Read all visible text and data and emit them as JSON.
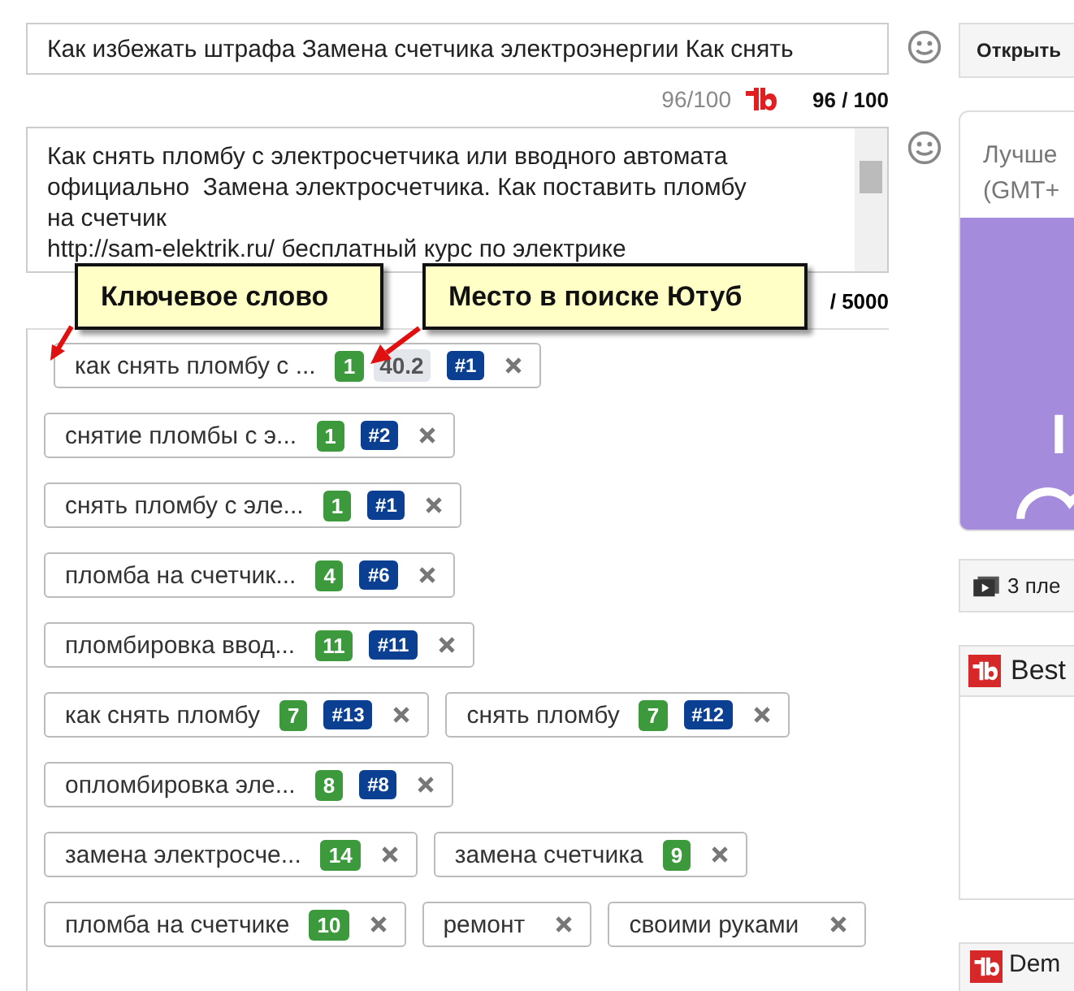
{
  "title_field": {
    "value": "Как избежать штрафа Замена счетчика электроэнергии Как снять"
  },
  "title_counter": {
    "tb_count": "96/100",
    "count": "96 / 100"
  },
  "description_field": {
    "lines": [
      "Как снять пломбу с электросчетчика или вводного автомата",
      "официально  Замена электросчетчика. Как поставить пломбу",
      "на счетчик",
      "http://sam-elektrik.ru/ бесплатный курс по электрике"
    ]
  },
  "description_counter": "/ 5000",
  "callouts": [
    "Ключевое слово",
    "Место в поиске Ютуб"
  ],
  "tag_rows": [
    [
      {
        "text": "как снять пломбу с ...",
        "count": "1",
        "score": "40.2",
        "rank": "#1"
      }
    ],
    [
      {
        "text": "снятие пломбы с э...",
        "count": "1",
        "rank": "#2"
      }
    ],
    [
      {
        "text": "снять пломбу с эле...",
        "count": "1",
        "rank": "#1"
      }
    ],
    [
      {
        "text": "пломба на счетчик...",
        "count": "4",
        "rank": "#6"
      }
    ],
    [
      {
        "text": "пломбировка ввод...",
        "count": "11",
        "rank": "#11"
      }
    ],
    [
      {
        "text": "как снять пломбу",
        "count": "7",
        "rank": "#13"
      },
      {
        "text": "снять пломбу",
        "count": "7",
        "rank": "#12"
      }
    ],
    [
      {
        "text": "опломбировка эле...",
        "count": "8",
        "rank": "#8"
      }
    ],
    [
      {
        "text": "замена электросче...",
        "count": "14"
      },
      {
        "text": "замена счетчика",
        "count": "9"
      }
    ],
    [
      {
        "text": "пломба на счетчике",
        "count": "10"
      },
      {
        "text": "ремонт"
      },
      {
        "text": "своими руками"
      }
    ]
  ],
  "sidebar": {
    "open_button": "Открыть",
    "schedule_card": {
      "lines": [
        "Лучше",
        "(GMT+"
      ]
    },
    "playlist_button": "3 пле",
    "best_panel": "Best",
    "demo_panel": "Dem"
  }
}
